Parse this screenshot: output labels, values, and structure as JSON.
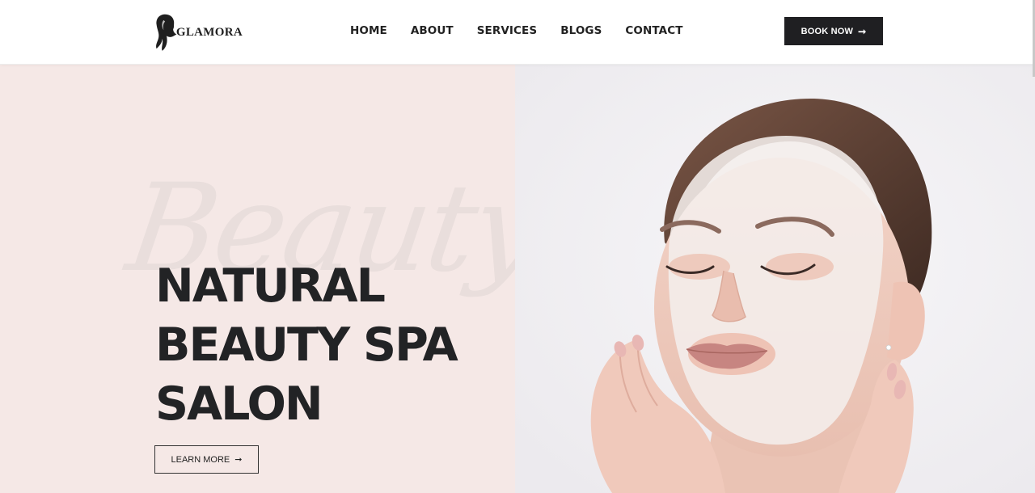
{
  "brand": {
    "name": "GLAMORA"
  },
  "nav": {
    "items": [
      {
        "label": "HOME"
      },
      {
        "label": "ABOUT"
      },
      {
        "label": "SERVICES"
      },
      {
        "label": "BLOGS"
      },
      {
        "label": "CONTACT"
      }
    ]
  },
  "header": {
    "cta_label": "BOOK NOW",
    "cta_icon": "arrow-right-icon"
  },
  "hero": {
    "script_word": "Beauty",
    "title_lines": [
      "NATURAL",
      "BEAUTY SPA",
      "SALON"
    ],
    "button_label": "LEARN MORE",
    "button_icon": "arrow-right-icon"
  },
  "colors": {
    "hero_left_bg": "#f5e8e6",
    "hero_right_bg": "#f3f2f4",
    "button_dark": "#1f1f22",
    "text_dark": "#222325"
  }
}
